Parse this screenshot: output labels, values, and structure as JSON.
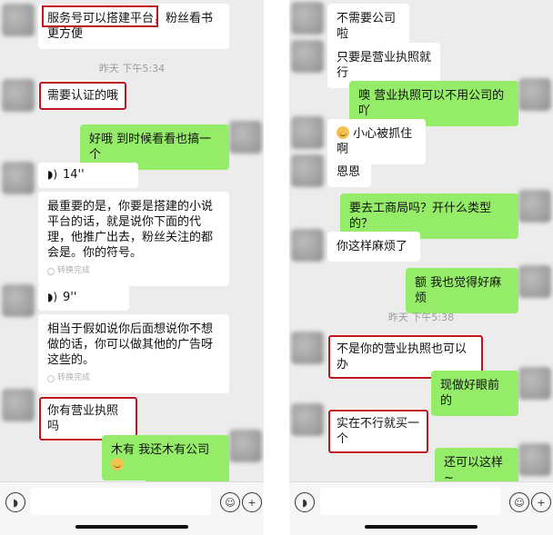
{
  "left": {
    "messages": {
      "m1": "服务号可以搭建平台，粉丝看书更方便",
      "t1": "昨天 下午5:34",
      "m2": "需要认证的哦",
      "m3": "好哦  到时候看看也搞一个",
      "v1": "14''",
      "m4": "最重要的是，你要是搭建的小说平台的话，就是说你下面的代理，他推广出去，粉丝关注的都会是。你的符号。",
      "c1": "转换完成",
      "v2": "9''",
      "m5": "相当于假如说你后面想说你不想做的话，你可以做其他的广告呀这些的。",
      "c2": "转换完成",
      "m6": "你有营业执照吗",
      "m7": "木有  我还木有公司"
    }
  },
  "right": {
    "messages": {
      "m1": "不需要公司啦",
      "m2": "只要是营业执照就行",
      "m3": "噢 营业执照可以不用公司的吖",
      "m4": "小心被抓住啊",
      "m5": "恩恩",
      "m6": "要去工商局吗？开什么类型的？",
      "m7": "你这样麻烦了",
      "m8": "额 我也觉得好麻烦",
      "t1": "昨天 下午5:38",
      "m9": "不是你的营业执照也可以办",
      "m10": "现做好眼前的",
      "m11": "实在不行就买一个",
      "m12": "还可以这样~"
    }
  },
  "icons": {
    "voice": "voice-icon",
    "emoji": "emoji-icon",
    "add": "plus-icon"
  }
}
